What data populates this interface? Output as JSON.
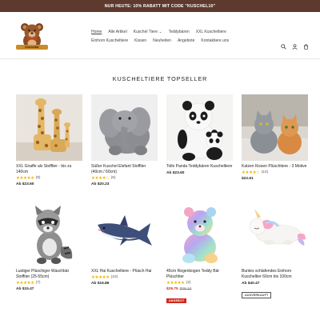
{
  "announcement": "NUR HEUTE: 10% RABATT MIT CODE \"KUSCHEL10\"",
  "logo_text": "Kuschelbär",
  "nav": {
    "row1": [
      "Home",
      "Alle Artikel",
      "Kuschel Tiere ⌄",
      "Teddybären",
      "XXL Kuscheltiere"
    ],
    "row2": [
      "Einhorn Kuscheltiere",
      "Kissen",
      "Neuheiten",
      "Angebote",
      "Kontaktiere uns"
    ]
  },
  "icons": [
    "search-icon",
    "account-icon",
    "cart-icon"
  ],
  "section_title": "KUSCHELTIERE TOPSELLER",
  "products": [
    {
      "title": "XXL Giraffe als Stofftier - bis zu 140cm",
      "stars": "★★★★★",
      "reviews": "(9)",
      "price": "Ab $23.60"
    },
    {
      "title": "Süßer Kuschel Elefant Stofftier (40cm / 60cm)",
      "stars": "★★★★☆",
      "reviews": "(6)",
      "price": "Ab $20.23"
    },
    {
      "title": "Tolle Panda Teddybären Kuscheltiere",
      "stars": "",
      "reviews": "",
      "price": "Ab $23.60"
    },
    {
      "title": "Katzen Kissen Plüschtiere - 3 Motive",
      "stars": "★★★★☆",
      "reviews": "(10)",
      "price": "$22.61"
    },
    {
      "title": "Lustiger Plüschiger Waschbär Stofftier (25-55cm)",
      "stars": "★★★★★",
      "reviews": "(7)",
      "price": "Ab $15.47"
    },
    {
      "title": "XXL Hai Kuscheltiere - Plüsch Hai",
      "stars": "★★★★★",
      "reviews": "(10)",
      "price": "Ab $16.86"
    },
    {
      "title": "45cm Regenbogen Teddy Bär Plüschtier",
      "stars": "★★★★★",
      "reviews": "(2)",
      "price_sale": "$29.75",
      "price_old": "$26.24",
      "badge": "ANGEBOT"
    },
    {
      "title": "Buntes schlafendes Einhorn Kuscheltier 60cm bis 100cm",
      "stars": "",
      "reviews": "",
      "price": "Ab $40.47",
      "badge": "AUSVERKAUFT"
    }
  ],
  "colors": {
    "announcement_bg": "#5e3a2e",
    "star": "#f2b600",
    "sale": "#d02a1e"
  }
}
